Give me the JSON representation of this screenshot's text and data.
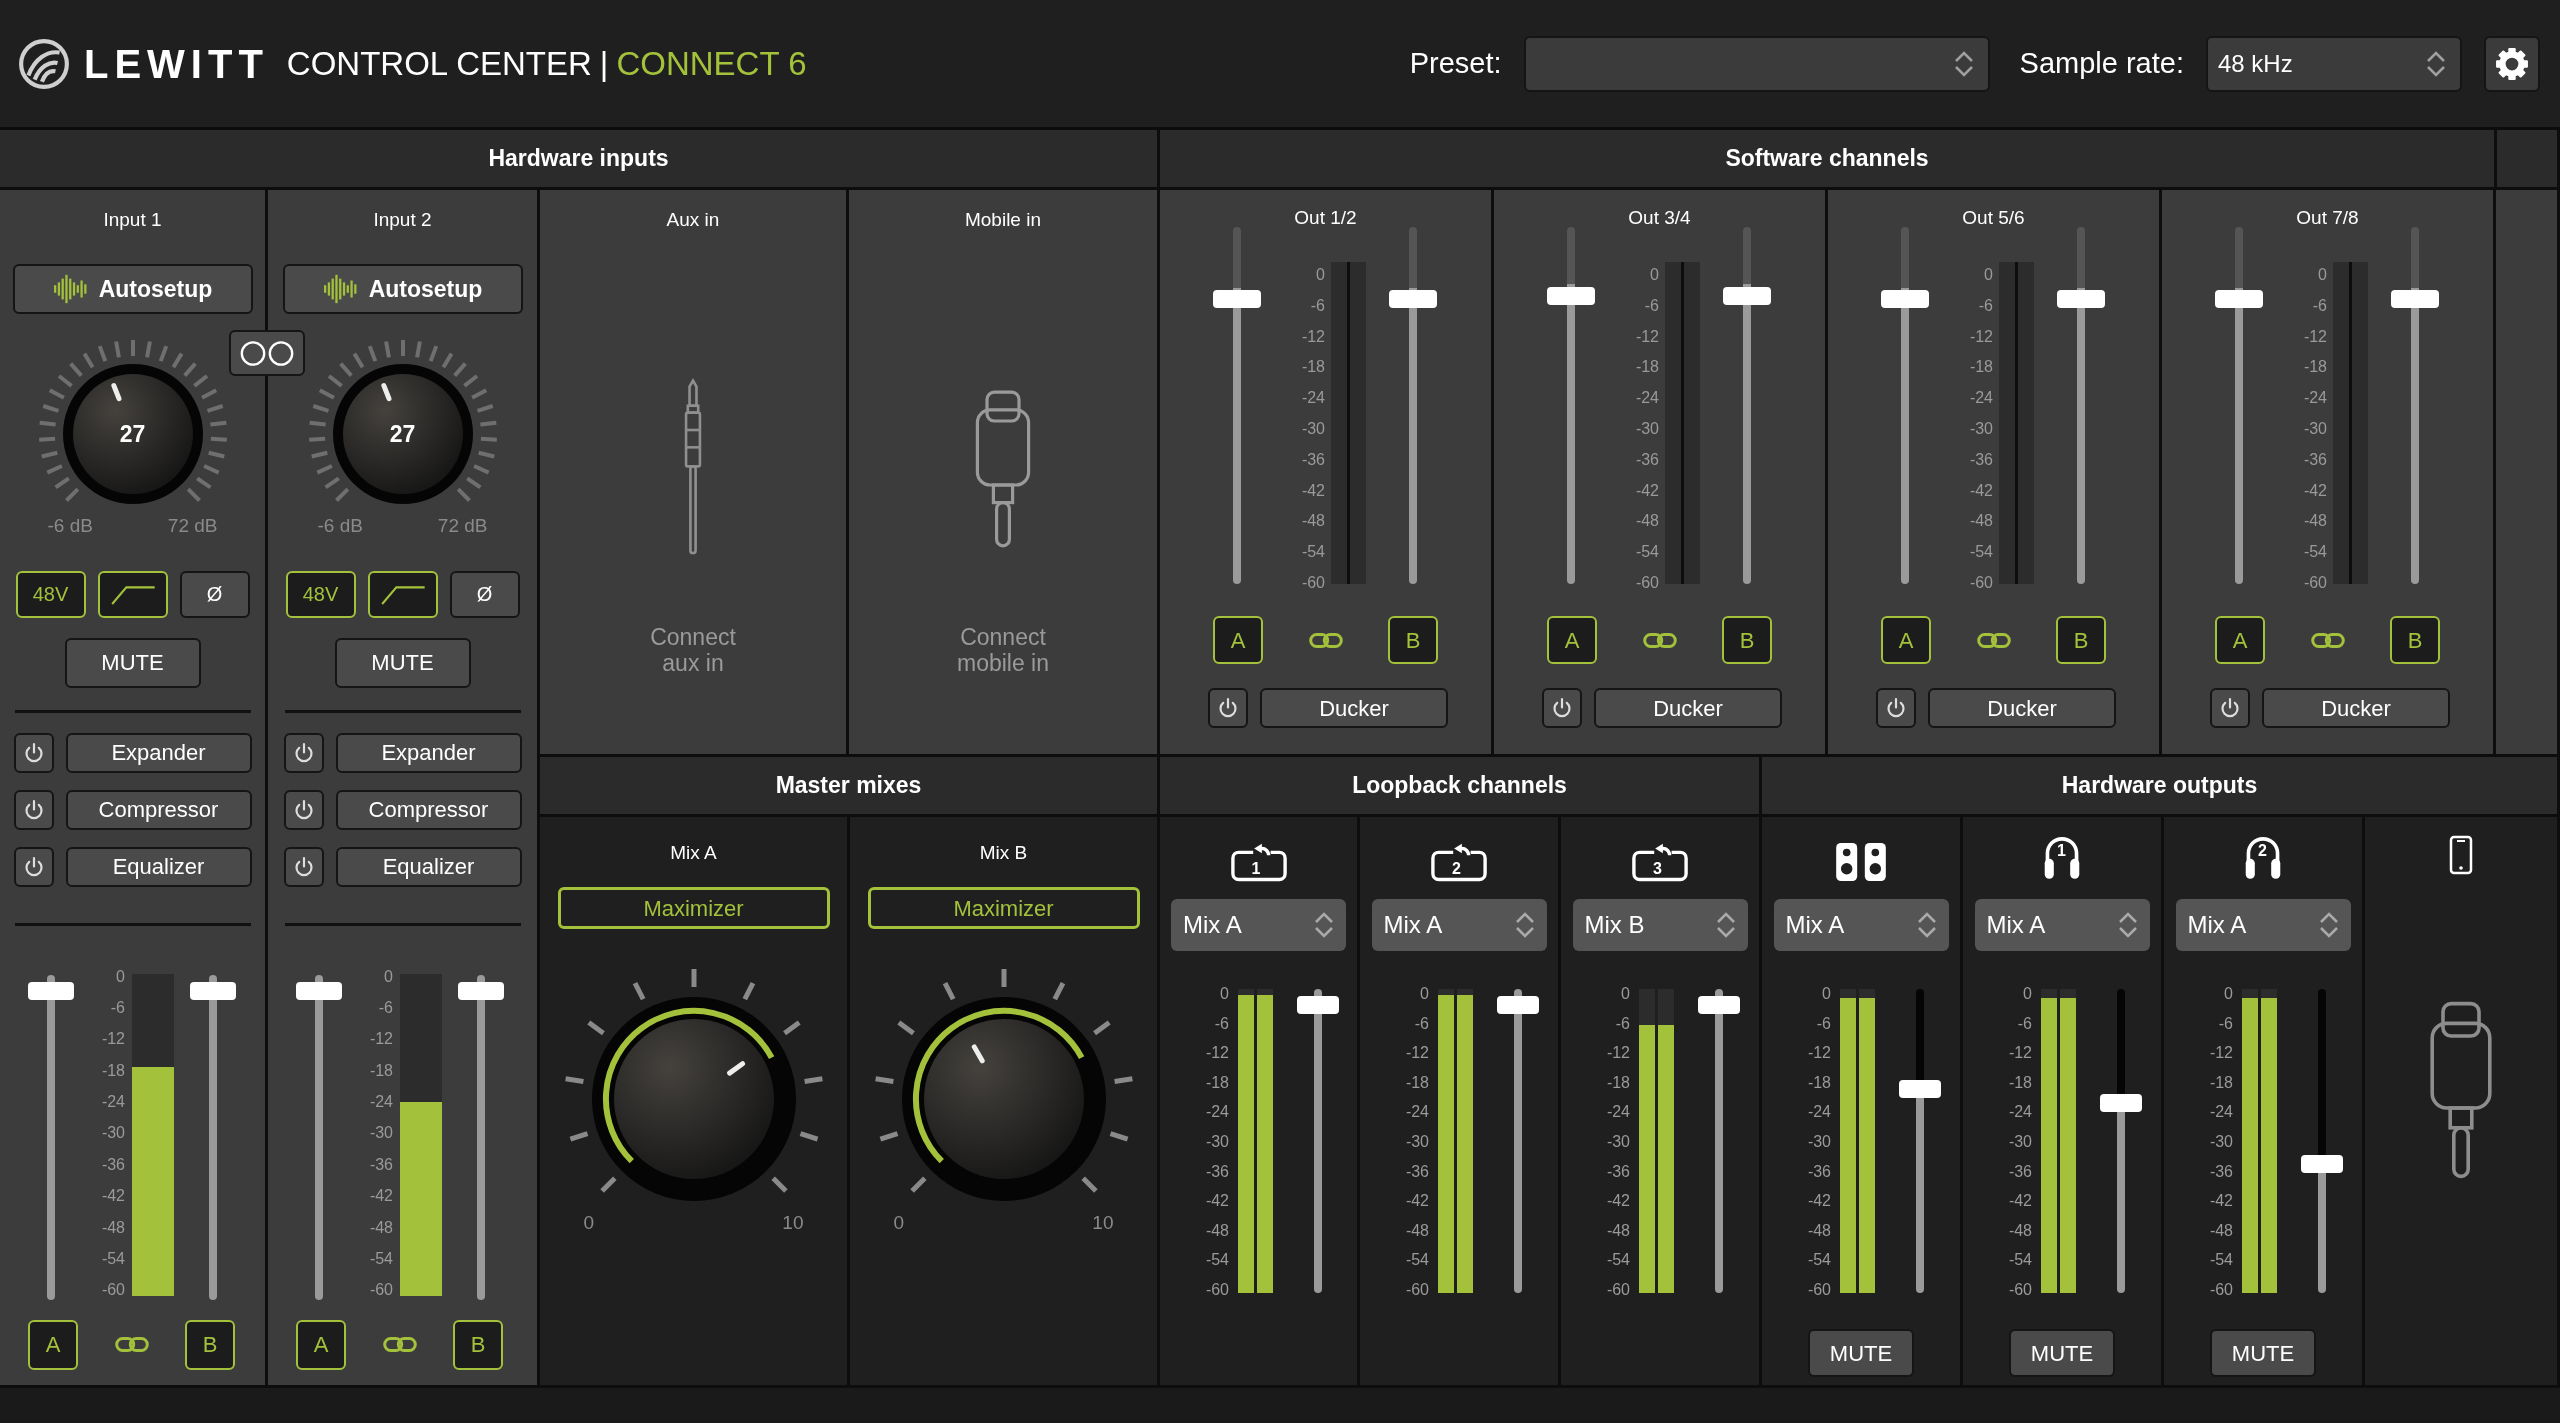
{
  "header": {
    "brand": "LEWITT",
    "title": "CONTROL CENTER",
    "separator": "|",
    "device": "CONNECT 6",
    "preset": {
      "label": "Preset:"
    },
    "sample_rate": {
      "label": "Sample rate:",
      "value": "48 kHz"
    }
  },
  "hardware_inputs": {
    "title": "Hardware inputs",
    "stereo_link": {
      "on": false
    },
    "inputs": [
      {
        "name": "Input 1",
        "autosetup": "Autosetup",
        "gain": {
          "value": "27",
          "level": 0.42,
          "min": "-6 dB",
          "max": "72 dB"
        },
        "toggles": [
          {
            "kind": "phantom",
            "label": "48V",
            "on": true
          },
          {
            "kind": "highpass",
            "on": true
          },
          {
            "kind": "phase",
            "label": "Ø",
            "on": false
          }
        ],
        "mute": {
          "label": "MUTE",
          "on": false
        },
        "processors": [
          {
            "label": "Expander",
            "on": false
          },
          {
            "label": "Compressor",
            "on": false
          },
          {
            "label": "Equalizer",
            "on": false
          }
        ],
        "fader_a": {
          "level": 1
        },
        "fader_b": {
          "level": 1
        },
        "meters": [
          {
            "level": 0.71
          }
        ],
        "scale": [
          "0",
          "-6",
          "-12",
          "-18",
          "-24",
          "-30",
          "-36",
          "-42",
          "-48",
          "-54",
          "-60"
        ],
        "route_a": {
          "label": "A",
          "selected": true
        },
        "route_b": {
          "label": "B",
          "selected": true
        },
        "linked": true
      },
      {
        "name": "Input 2",
        "autosetup": "Autosetup",
        "gain": {
          "value": "27",
          "level": 0.42,
          "min": "-6 dB",
          "max": "72 dB"
        },
        "toggles": [
          {
            "kind": "phantom",
            "label": "48V",
            "on": true
          },
          {
            "kind": "highpass",
            "on": true
          },
          {
            "kind": "phase",
            "label": "Ø",
            "on": false
          }
        ],
        "mute": {
          "label": "MUTE",
          "on": false
        },
        "processors": [
          {
            "label": "Expander",
            "on": false
          },
          {
            "label": "Compressor",
            "on": false
          },
          {
            "label": "Equalizer",
            "on": false
          }
        ],
        "fader_a": {
          "level": 1
        },
        "fader_b": {
          "level": 1
        },
        "meters": [
          {
            "level": 0.6
          }
        ],
        "scale": [
          "0",
          "-6",
          "-12",
          "-18",
          "-24",
          "-30",
          "-36",
          "-42",
          "-48",
          "-54",
          "-60"
        ],
        "route_a": {
          "label": "A",
          "selected": true
        },
        "route_b": {
          "label": "B",
          "selected": true
        },
        "linked": true
      }
    ],
    "aux": {
      "name": "Aux in",
      "hint": "Connect aux in"
    },
    "mobile": {
      "name": "Mobile in",
      "hint": "Connect mobile in"
    }
  },
  "software_channels": {
    "title": "Software channels",
    "outputs": [
      {
        "name": "Out 1/2",
        "fader_a": {
          "level": 0.83
        },
        "fader_b": {
          "level": 0.83
        },
        "scale": [
          "0",
          "-6",
          "-12",
          "-18",
          "-24",
          "-30",
          "-36",
          "-42",
          "-48",
          "-54",
          "-60"
        ],
        "route_a": {
          "label": "A",
          "selected": true
        },
        "route_b": {
          "label": "B",
          "selected": true
        },
        "linked": true,
        "ducker": {
          "label": "Ducker",
          "on": false
        }
      },
      {
        "name": "Out 3/4",
        "fader_a": {
          "level": 0.84
        },
        "fader_b": {
          "level": 0.84
        },
        "scale": [
          "0",
          "-6",
          "-12",
          "-18",
          "-24",
          "-30",
          "-36",
          "-42",
          "-48",
          "-54",
          "-60"
        ],
        "route_a": {
          "label": "A",
          "selected": true
        },
        "route_b": {
          "label": "B",
          "selected": true
        },
        "linked": true,
        "ducker": {
          "label": "Ducker",
          "on": false
        }
      },
      {
        "name": "Out 5/6",
        "fader_a": {
          "level": 0.83
        },
        "fader_b": {
          "level": 0.83
        },
        "scale": [
          "0",
          "-6",
          "-12",
          "-18",
          "-24",
          "-30",
          "-36",
          "-42",
          "-48",
          "-54",
          "-60"
        ],
        "route_a": {
          "label": "A",
          "selected": true
        },
        "route_b": {
          "label": "B",
          "selected": true
        },
        "linked": true,
        "ducker": {
          "label": "Ducker",
          "on": false
        }
      },
      {
        "name": "Out 7/8",
        "fader_a": {
          "level": 0.83
        },
        "fader_b": {
          "level": 0.83
        },
        "scale": [
          "0",
          "-6",
          "-12",
          "-18",
          "-24",
          "-30",
          "-36",
          "-42",
          "-48",
          "-54",
          "-60"
        ],
        "route_a": {
          "label": "A",
          "selected": true
        },
        "route_b": {
          "label": "B",
          "selected": true
        },
        "linked": true,
        "ducker": {
          "label": "Ducker",
          "on": false
        }
      }
    ]
  },
  "master_mixes": {
    "title": "Master mixes",
    "mixes": [
      {
        "name": "Mix A",
        "maximizer": {
          "label": "Maximizer",
          "on": true
        },
        "knob": {
          "level": 0.7
        },
        "min": "0",
        "max": "10"
      },
      {
        "name": "Mix B",
        "maximizer": {
          "label": "Maximizer",
          "on": true
        },
        "knob": {
          "level": 0.39
        },
        "min": "0",
        "max": "10"
      }
    ]
  },
  "loopback_channels": {
    "title": "Loopback channels",
    "channels": [
      {
        "number": "1",
        "source": "Mix A",
        "meters": [
          {
            "level": 0.98
          },
          {
            "level": 0.98
          }
        ],
        "fader": {
          "level": 1
        },
        "scale": [
          "0",
          "-6",
          "-12",
          "-18",
          "-24",
          "-30",
          "-36",
          "-42",
          "-48",
          "-54",
          "-60"
        ]
      },
      {
        "number": "2",
        "source": "Mix A",
        "meters": [
          {
            "level": 0.98
          },
          {
            "level": 0.98
          }
        ],
        "fader": {
          "level": 1
        },
        "scale": [
          "0",
          "-6",
          "-12",
          "-18",
          "-24",
          "-30",
          "-36",
          "-42",
          "-48",
          "-54",
          "-60"
        ]
      },
      {
        "number": "3",
        "source": "Mix B",
        "meters": [
          {
            "level": 0.88
          },
          {
            "level": 0.88
          }
        ],
        "fader": {
          "level": 1
        },
        "scale": [
          "0",
          "-6",
          "-12",
          "-18",
          "-24",
          "-30",
          "-36",
          "-42",
          "-48",
          "-54",
          "-60"
        ]
      }
    ]
  },
  "hardware_outputs": {
    "title": "Hardware outputs",
    "outputs": [
      {
        "kind": "speakers",
        "source": "Mix A",
        "meters": [
          {
            "level": 0.97
          },
          {
            "level": 0.97
          }
        ],
        "fader": {
          "level": 0.7
        },
        "mute": {
          "label": "MUTE",
          "on": false
        },
        "scale": [
          "0",
          "-6",
          "-12",
          "-18",
          "-24",
          "-30",
          "-36",
          "-42",
          "-48",
          "-54",
          "-60"
        ]
      },
      {
        "kind": "headphones",
        "number": "1",
        "source": "Mix A",
        "meters": [
          {
            "level": 0.97
          },
          {
            "level": 0.97
          }
        ],
        "fader": {
          "level": 0.65
        },
        "mute": {
          "label": "MUTE",
          "on": false
        },
        "scale": [
          "0",
          "-6",
          "-12",
          "-18",
          "-24",
          "-30",
          "-36",
          "-42",
          "-48",
          "-54",
          "-60"
        ]
      },
      {
        "kind": "headphones",
        "number": "2",
        "source": "Mix A",
        "meters": [
          {
            "level": 0.97
          },
          {
            "level": 0.97
          }
        ],
        "fader": {
          "level": 0.43
        },
        "mute": {
          "label": "MUTE",
          "on": false
        },
        "scale": [
          "0",
          "-6",
          "-12",
          "-18",
          "-24",
          "-30",
          "-36",
          "-42",
          "-48",
          "-54",
          "-60"
        ]
      },
      {
        "kind": "mobile"
      }
    ]
  }
}
